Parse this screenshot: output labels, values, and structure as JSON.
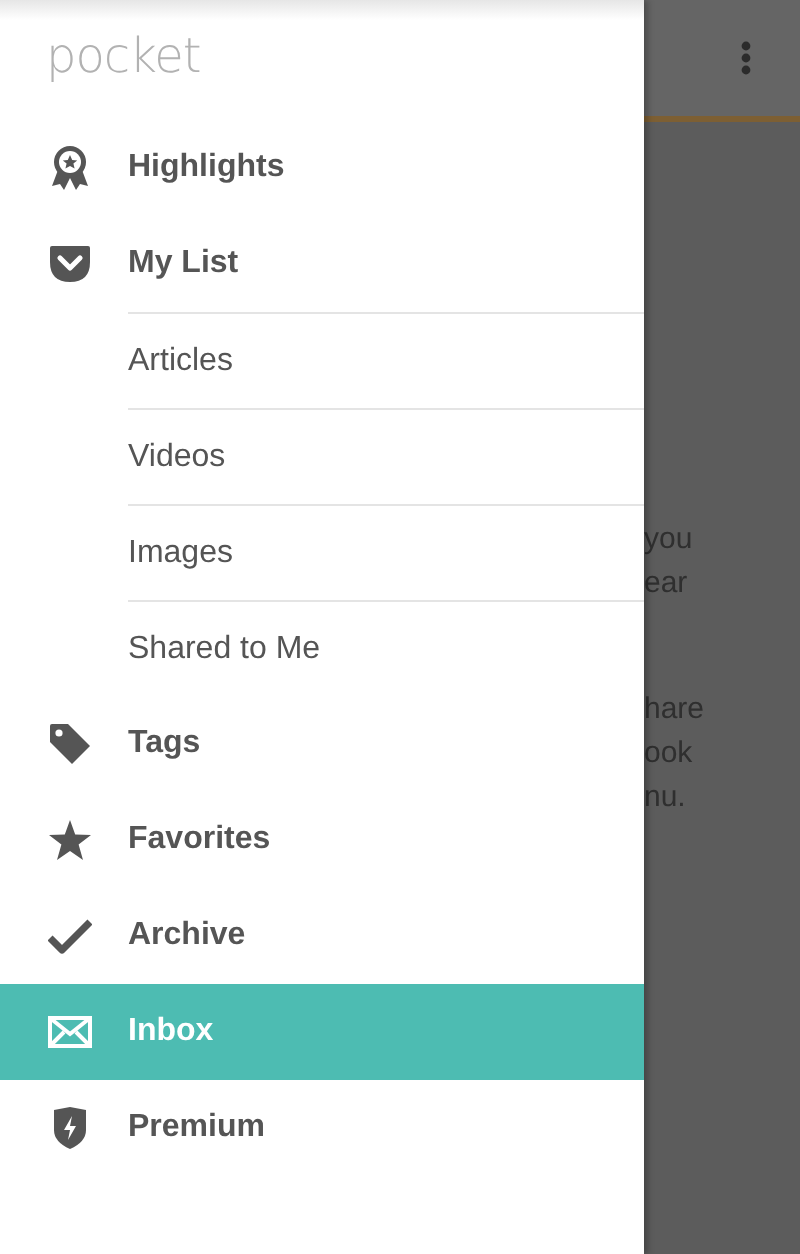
{
  "drawer": {
    "logo": "pocket",
    "items": [
      {
        "label": "Highlights",
        "selected": false
      },
      {
        "label": "My List",
        "selected": false,
        "children": [
          {
            "label": "Articles",
            "selected": false
          },
          {
            "label": "Videos",
            "selected": false
          },
          {
            "label": "Images",
            "selected": false
          },
          {
            "label": "Shared to Me",
            "selected": false
          }
        ]
      },
      {
        "label": "Tags",
        "selected": false
      },
      {
        "label": "Favorites",
        "selected": false
      },
      {
        "label": "Archive",
        "selected": false
      },
      {
        "label": "Inbox",
        "selected": true
      },
      {
        "label": "Premium",
        "selected": false
      }
    ]
  },
  "background": {
    "paragraphs": [
      {
        "lines": [
          "you",
          "ear"
        ]
      },
      {
        "lines": [
          "hare",
          "ook",
          "nu."
        ]
      }
    ]
  }
}
